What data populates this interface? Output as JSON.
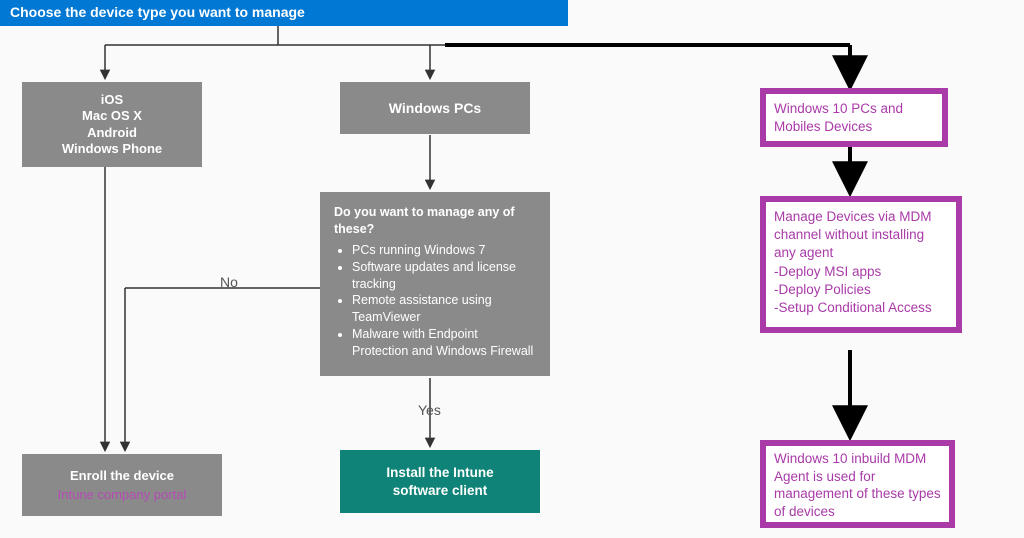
{
  "header": {
    "title": "Choose the device type you want to manage"
  },
  "col1": {
    "devices": [
      "iOS",
      "Mac OS X",
      "Android",
      "Windows Phone"
    ],
    "enroll": {
      "line1": "Enroll the device",
      "line2": "Intune company portal"
    }
  },
  "col2": {
    "winpcs": "Windows PCs",
    "decision": {
      "question": "Do you want to manage any of these?",
      "items": [
        "PCs running Windows 7",
        "Software updates and license tracking",
        "Remote assistance using TeamViewer",
        "Malware with Endpoint Protection and Windows Firewall"
      ]
    },
    "install": {
      "line1": "Install the Intune",
      "line2": "software client"
    }
  },
  "col3": {
    "win10": "Windows 10 PCs and Mobiles Devices",
    "mdm": {
      "lines": [
        "Manage Devices via MDM channel without installing any agent",
        "-Deploy MSI apps",
        "-Deploy Policies",
        "-Setup Conditional Access"
      ]
    },
    "note": "Windows 10 inbuild MDM Agent is used for management of these types of devices"
  },
  "edges": {
    "no": "No",
    "yes": "Yes"
  }
}
